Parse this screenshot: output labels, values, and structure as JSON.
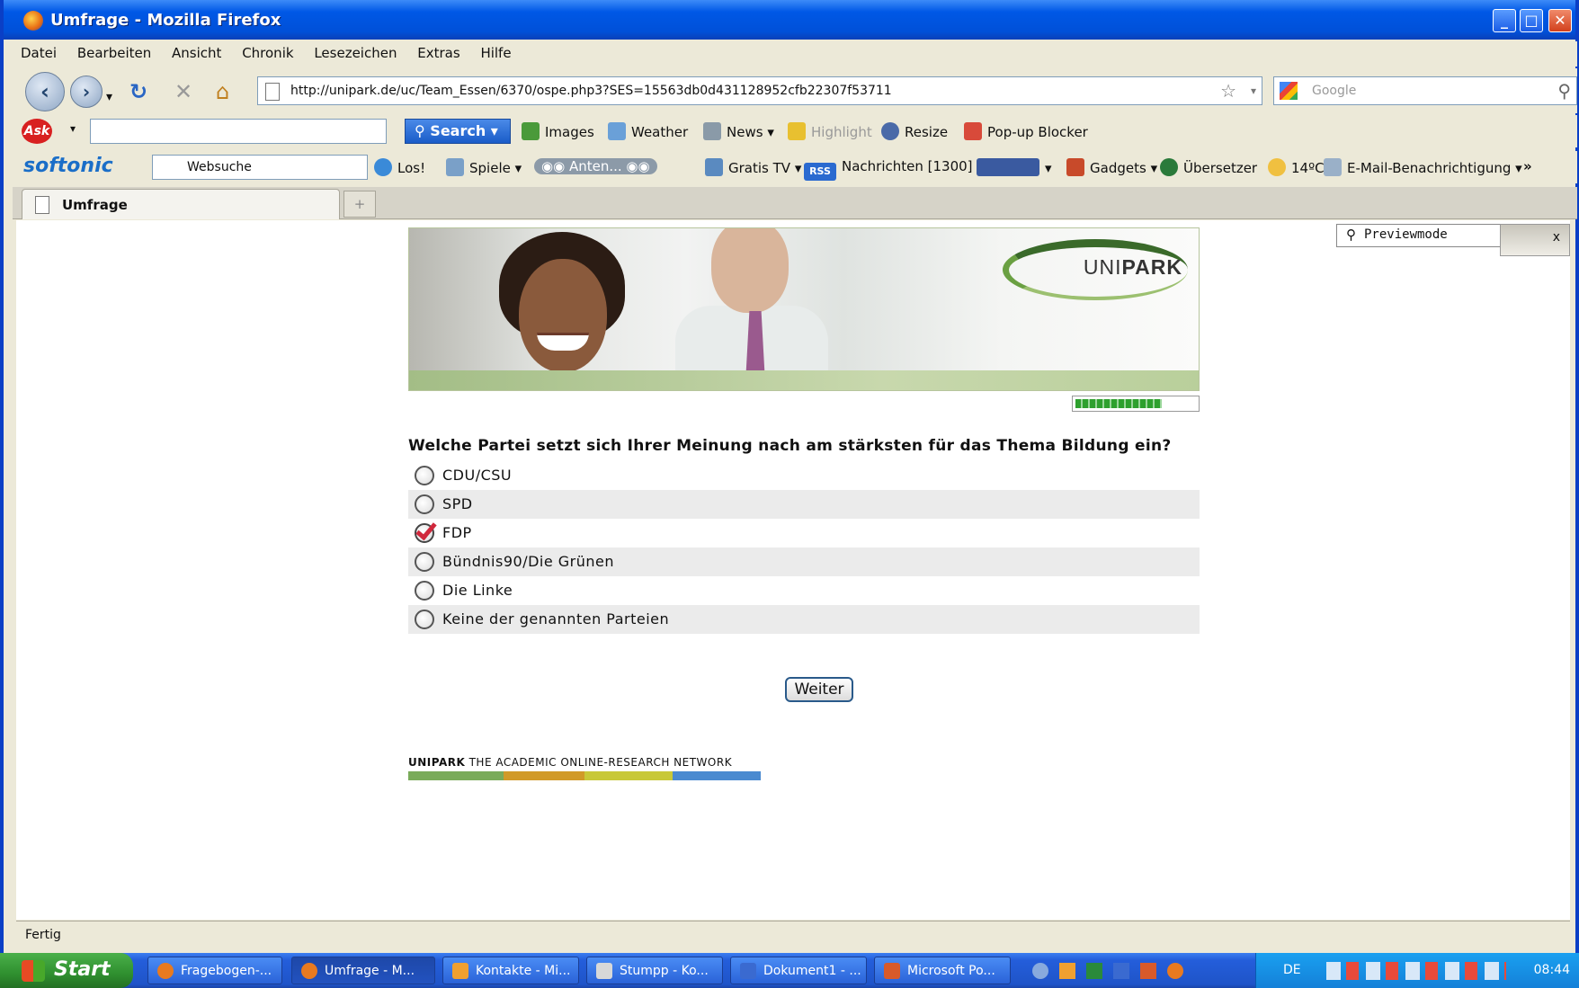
{
  "window": {
    "title": "Umfrage - Mozilla Firefox"
  },
  "menu": [
    "Datei",
    "Bearbeiten",
    "Ansicht",
    "Chronik",
    "Lesezeichen",
    "Extras",
    "Hilfe"
  ],
  "nav": {
    "url": "http://unipark.de/uc/Team_Essen/6370/ospe.php3?SES=15563db0d431128952cfb22307f53711",
    "search_placeholder": "Google"
  },
  "ask_toolbar": {
    "search_label": "Search",
    "items": [
      "Images",
      "Weather",
      "News",
      "Highlight",
      "Resize",
      "Pop-up Blocker"
    ]
  },
  "softonic_toolbar": {
    "brand": "softonic",
    "search_value": "Websuche",
    "items": [
      "Los!",
      "Spiele",
      "Anten...",
      "Gratis TV",
      "Nachrichten [1300]",
      "Gadgets",
      "Übersetzer",
      "14ºC",
      "E-Mail-Benachrichtigung"
    ],
    "rss_label": "RSS",
    "more": "»"
  },
  "tab": {
    "label": "Umfrage",
    "new_tab": "+"
  },
  "preview": {
    "label": "Previewmode",
    "close": "x"
  },
  "survey": {
    "logo_light": "UNI",
    "logo_bold": "PARK",
    "progress": 0.72,
    "question": "Welche Partei setzt sich Ihrer Meinung nach am stärksten für das Thema Bildung ein?",
    "options": [
      {
        "label": "CDU/CSU",
        "checked": false
      },
      {
        "label": "SPD",
        "checked": false
      },
      {
        "label": "FDP",
        "checked": true
      },
      {
        "label": "Bündnis90/Die Grünen",
        "checked": false
      },
      {
        "label": "Die Linke",
        "checked": false
      },
      {
        "label": "Keine der genannten Parteien",
        "checked": false
      }
    ],
    "next_button": "Weiter",
    "footer_brand": "UNIPARK",
    "footer_tagline": " THE ACADEMIC ONLINE-RESEARCH NETWORK"
  },
  "status": "Fertig",
  "taskbar": {
    "start": "Start",
    "buttons": [
      "Fragebogen-...",
      "Umfrage - M...",
      "Kontakte - Mi...",
      "Stumpp - Ko...",
      "Dokument1 - ...",
      "Microsoft Po..."
    ],
    "language": "DE",
    "clock": "08:44"
  }
}
